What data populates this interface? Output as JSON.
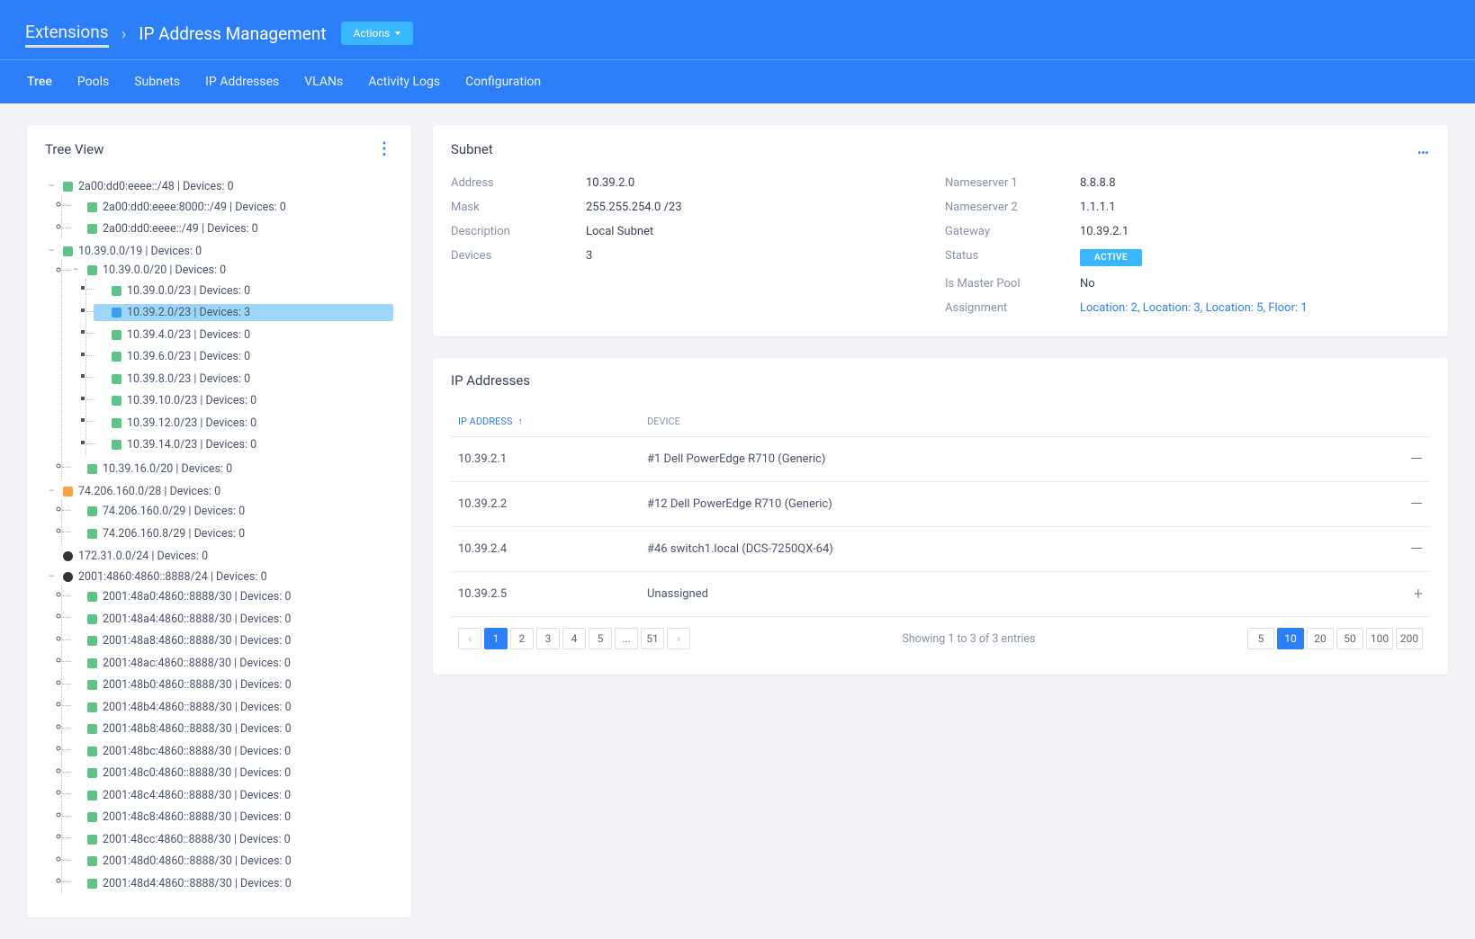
{
  "header": {
    "breadcrumb_parent": "Extensions",
    "breadcrumb_current": "IP Address Management",
    "actions_label": "Actions"
  },
  "tabs": [
    "Tree",
    "Pools",
    "Subnets",
    "IP Addresses",
    "VLANs",
    "Activity Logs",
    "Configuration"
  ],
  "tree": {
    "title": "Tree View",
    "nodes": [
      {
        "label": "2a00:dd0:eeee::/48 | Devices: 0",
        "icon": "green",
        "children": [
          {
            "label": "2a00:dd0:eeee:8000::/49 | Devices: 0",
            "icon": "green"
          },
          {
            "label": "2a00:dd0:eeee::/49 | Devices: 0",
            "icon": "green"
          }
        ]
      },
      {
        "label": "10.39.0.0/19 | Devices: 0",
        "icon": "green",
        "children": [
          {
            "label": "10.39.0.0/20 | Devices: 0",
            "icon": "green",
            "children": [
              {
                "label": "10.39.0.0/23 | Devices: 0",
                "icon": "green"
              },
              {
                "label": "10.39.2.0/23 | Devices: 3",
                "icon": "blue",
                "selected": true
              },
              {
                "label": "10.39.4.0/23 | Devices: 0",
                "icon": "green"
              },
              {
                "label": "10.39.6.0/23 | Devices: 0",
                "icon": "green"
              },
              {
                "label": "10.39.8.0/23 | Devices: 0",
                "icon": "green"
              },
              {
                "label": "10.39.10.0/23 | Devices: 0",
                "icon": "green"
              },
              {
                "label": "10.39.12.0/23 | Devices: 0",
                "icon": "green"
              },
              {
                "label": "10.39.14.0/23 | Devices: 0",
                "icon": "green"
              }
            ]
          },
          {
            "label": "10.39.16.0/20 | Devices: 0",
            "icon": "green"
          }
        ]
      },
      {
        "label": "74.206.160.0/28 | Devices: 0",
        "icon": "orange",
        "children": [
          {
            "label": "74.206.160.0/29 | Devices: 0",
            "icon": "green"
          },
          {
            "label": "74.206.160.8/29 | Devices: 0",
            "icon": "green"
          }
        ]
      },
      {
        "label": "172.31.0.0/24 | Devices: 0",
        "icon": "dark"
      },
      {
        "label": "2001:4860:4860::8888/24 | Devices: 0",
        "icon": "dark",
        "children": [
          {
            "label": "2001:48a0:4860::8888/30 | Devices: 0",
            "icon": "green"
          },
          {
            "label": "2001:48a4:4860::8888/30 | Devices: 0",
            "icon": "green"
          },
          {
            "label": "2001:48a8:4860::8888/30 | Devices: 0",
            "icon": "green"
          },
          {
            "label": "2001:48ac:4860::8888/30 | Devices: 0",
            "icon": "green"
          },
          {
            "label": "2001:48b0:4860::8888/30 | Devices: 0",
            "icon": "green"
          },
          {
            "label": "2001:48b4:4860::8888/30 | Devices: 0",
            "icon": "green"
          },
          {
            "label": "2001:48b8:4860::8888/30 | Devices: 0",
            "icon": "green"
          },
          {
            "label": "2001:48bc:4860::8888/30 | Devices: 0",
            "icon": "green"
          },
          {
            "label": "2001:48c0:4860::8888/30 | Devices: 0",
            "icon": "green"
          },
          {
            "label": "2001:48c4:4860::8888/30 | Devices: 0",
            "icon": "green"
          },
          {
            "label": "2001:48c8:4860::8888/30 | Devices: 0",
            "icon": "green"
          },
          {
            "label": "2001:48cc:4860::8888/30 | Devices: 0",
            "icon": "green"
          },
          {
            "label": "2001:48d0:4860::8888/30 | Devices: 0",
            "icon": "green"
          },
          {
            "label": "2001:48d4:4860::8888/30 | Devices: 0",
            "icon": "green"
          }
        ]
      }
    ]
  },
  "subnet": {
    "title": "Subnet",
    "address_label": "Address",
    "address": "10.39.2.0",
    "mask_label": "Mask",
    "mask": "255.255.254.0 /23",
    "description_label": "Description",
    "description": "Local Subnet",
    "devices_label": "Devices",
    "devices": "3",
    "ns1_label": "Nameserver 1",
    "ns1": "8.8.8.8",
    "ns2_label": "Nameserver 2",
    "ns2": "1.1.1.1",
    "gateway_label": "Gateway",
    "gateway": "10.39.2.1",
    "status_label": "Status",
    "status": "ACTIVE",
    "master_label": "Is Master Pool",
    "master": "No",
    "assignment_label": "Assignment",
    "assignment": "Location: 2, Location: 3, Location: 5, Floor: 1"
  },
  "ip": {
    "title": "IP Addresses",
    "col_ip": "IP ADDRESS",
    "col_dev": "DEVICE",
    "rows": [
      {
        "ip": "10.39.2.1",
        "device": "#1 Dell PowerEdge R710 (Generic)",
        "action": "—"
      },
      {
        "ip": "10.39.2.2",
        "device": "#12 Dell PowerEdge R710 (Generic)",
        "action": "—"
      },
      {
        "ip": "10.39.2.4",
        "device": "#46 switch1.local (DCS-7250QX-64)",
        "action": "—"
      },
      {
        "ip": "10.39.2.5",
        "device": "Unassigned",
        "action": "+"
      }
    ],
    "pages": [
      "1",
      "2",
      "3",
      "4",
      "5",
      "...",
      "51"
    ],
    "info": "Showing 1 to 3 of 3 entries",
    "sizes": [
      "5",
      "10",
      "20",
      "50",
      "100",
      "200"
    ],
    "active_size": "10"
  }
}
